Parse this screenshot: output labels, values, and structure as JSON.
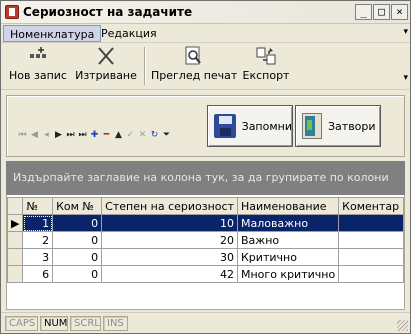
{
  "window": {
    "title": "Сериозност на задачите",
    "minimize_glyph": "_",
    "maximize_glyph": "□",
    "close_glyph": "×"
  },
  "menu": {
    "items": [
      {
        "label": "Номенклатура"
      },
      {
        "label": "Редакция"
      }
    ],
    "overflow_glyph": "▾"
  },
  "toolbar": {
    "new_label": "Нов запис",
    "delete_label": "Изтриване",
    "preview_label": "Преглед печат",
    "export_label": "Експорт",
    "overflow_glyph": "▾"
  },
  "actions": {
    "save_label": "Запомни",
    "close_label": "Затвори"
  },
  "navigator": {
    "buttons": [
      "first",
      "prior-page",
      "prior",
      "next",
      "next-page",
      "last",
      "insert",
      "delete",
      "edit",
      "post",
      "cancel",
      "refresh",
      "filter"
    ]
  },
  "group_panel": {
    "hint": "Издърпайте заглавие на колона тук, за да групирате по колони"
  },
  "grid": {
    "columns": [
      "№",
      "Ком №",
      "Степен на сериозност",
      "Наименование",
      "Коментар"
    ],
    "rows": [
      {
        "num": "1",
        "com": "0",
        "severity": "10",
        "name": "Маловажно",
        "note": "",
        "selected": true
      },
      {
        "num": "2",
        "com": "0",
        "severity": "20",
        "name": "Важно",
        "note": "",
        "selected": false
      },
      {
        "num": "3",
        "com": "0",
        "severity": "30",
        "name": "Критично",
        "note": "",
        "selected": false
      },
      {
        "num": "6",
        "com": "0",
        "severity": "42",
        "name": "Много критично",
        "note": "",
        "selected": false
      }
    ]
  },
  "status": {
    "caps": "CAPS",
    "num": "NUM",
    "scrl": "SCRL",
    "ins": "INS"
  }
}
